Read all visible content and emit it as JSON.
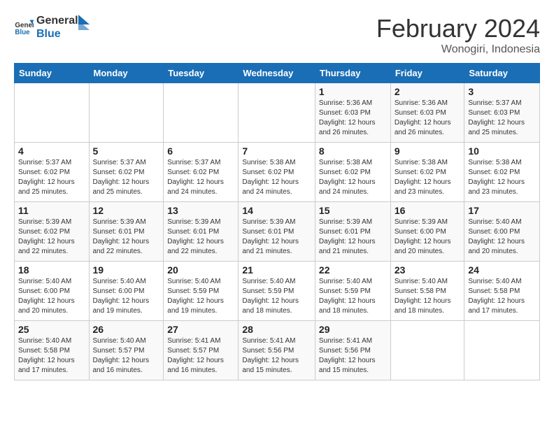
{
  "header": {
    "logo_line1": "General",
    "logo_line2": "Blue",
    "month_year": "February 2024",
    "location": "Wonogiri, Indonesia"
  },
  "weekdays": [
    "Sunday",
    "Monday",
    "Tuesday",
    "Wednesday",
    "Thursday",
    "Friday",
    "Saturday"
  ],
  "weeks": [
    [
      {
        "day": "",
        "info": ""
      },
      {
        "day": "",
        "info": ""
      },
      {
        "day": "",
        "info": ""
      },
      {
        "day": "",
        "info": ""
      },
      {
        "day": "1",
        "info": "Sunrise: 5:36 AM\nSunset: 6:03 PM\nDaylight: 12 hours\nand 26 minutes."
      },
      {
        "day": "2",
        "info": "Sunrise: 5:36 AM\nSunset: 6:03 PM\nDaylight: 12 hours\nand 26 minutes."
      },
      {
        "day": "3",
        "info": "Sunrise: 5:37 AM\nSunset: 6:03 PM\nDaylight: 12 hours\nand 25 minutes."
      }
    ],
    [
      {
        "day": "4",
        "info": "Sunrise: 5:37 AM\nSunset: 6:02 PM\nDaylight: 12 hours\nand 25 minutes."
      },
      {
        "day": "5",
        "info": "Sunrise: 5:37 AM\nSunset: 6:02 PM\nDaylight: 12 hours\nand 25 minutes."
      },
      {
        "day": "6",
        "info": "Sunrise: 5:37 AM\nSunset: 6:02 PM\nDaylight: 12 hours\nand 24 minutes."
      },
      {
        "day": "7",
        "info": "Sunrise: 5:38 AM\nSunset: 6:02 PM\nDaylight: 12 hours\nand 24 minutes."
      },
      {
        "day": "8",
        "info": "Sunrise: 5:38 AM\nSunset: 6:02 PM\nDaylight: 12 hours\nand 24 minutes."
      },
      {
        "day": "9",
        "info": "Sunrise: 5:38 AM\nSunset: 6:02 PM\nDaylight: 12 hours\nand 23 minutes."
      },
      {
        "day": "10",
        "info": "Sunrise: 5:38 AM\nSunset: 6:02 PM\nDaylight: 12 hours\nand 23 minutes."
      }
    ],
    [
      {
        "day": "11",
        "info": "Sunrise: 5:39 AM\nSunset: 6:02 PM\nDaylight: 12 hours\nand 22 minutes."
      },
      {
        "day": "12",
        "info": "Sunrise: 5:39 AM\nSunset: 6:01 PM\nDaylight: 12 hours\nand 22 minutes."
      },
      {
        "day": "13",
        "info": "Sunrise: 5:39 AM\nSunset: 6:01 PM\nDaylight: 12 hours\nand 22 minutes."
      },
      {
        "day": "14",
        "info": "Sunrise: 5:39 AM\nSunset: 6:01 PM\nDaylight: 12 hours\nand 21 minutes."
      },
      {
        "day": "15",
        "info": "Sunrise: 5:39 AM\nSunset: 6:01 PM\nDaylight: 12 hours\nand 21 minutes."
      },
      {
        "day": "16",
        "info": "Sunrise: 5:39 AM\nSunset: 6:00 PM\nDaylight: 12 hours\nand 20 minutes."
      },
      {
        "day": "17",
        "info": "Sunrise: 5:40 AM\nSunset: 6:00 PM\nDaylight: 12 hours\nand 20 minutes."
      }
    ],
    [
      {
        "day": "18",
        "info": "Sunrise: 5:40 AM\nSunset: 6:00 PM\nDaylight: 12 hours\nand 20 minutes."
      },
      {
        "day": "19",
        "info": "Sunrise: 5:40 AM\nSunset: 6:00 PM\nDaylight: 12 hours\nand 19 minutes."
      },
      {
        "day": "20",
        "info": "Sunrise: 5:40 AM\nSunset: 5:59 PM\nDaylight: 12 hours\nand 19 minutes."
      },
      {
        "day": "21",
        "info": "Sunrise: 5:40 AM\nSunset: 5:59 PM\nDaylight: 12 hours\nand 18 minutes."
      },
      {
        "day": "22",
        "info": "Sunrise: 5:40 AM\nSunset: 5:59 PM\nDaylight: 12 hours\nand 18 minutes."
      },
      {
        "day": "23",
        "info": "Sunrise: 5:40 AM\nSunset: 5:58 PM\nDaylight: 12 hours\nand 18 minutes."
      },
      {
        "day": "24",
        "info": "Sunrise: 5:40 AM\nSunset: 5:58 PM\nDaylight: 12 hours\nand 17 minutes."
      }
    ],
    [
      {
        "day": "25",
        "info": "Sunrise: 5:40 AM\nSunset: 5:58 PM\nDaylight: 12 hours\nand 17 minutes."
      },
      {
        "day": "26",
        "info": "Sunrise: 5:40 AM\nSunset: 5:57 PM\nDaylight: 12 hours\nand 16 minutes."
      },
      {
        "day": "27",
        "info": "Sunrise: 5:41 AM\nSunset: 5:57 PM\nDaylight: 12 hours\nand 16 minutes."
      },
      {
        "day": "28",
        "info": "Sunrise: 5:41 AM\nSunset: 5:56 PM\nDaylight: 12 hours\nand 15 minutes."
      },
      {
        "day": "29",
        "info": "Sunrise: 5:41 AM\nSunset: 5:56 PM\nDaylight: 12 hours\nand 15 minutes."
      },
      {
        "day": "",
        "info": ""
      },
      {
        "day": "",
        "info": ""
      }
    ]
  ]
}
